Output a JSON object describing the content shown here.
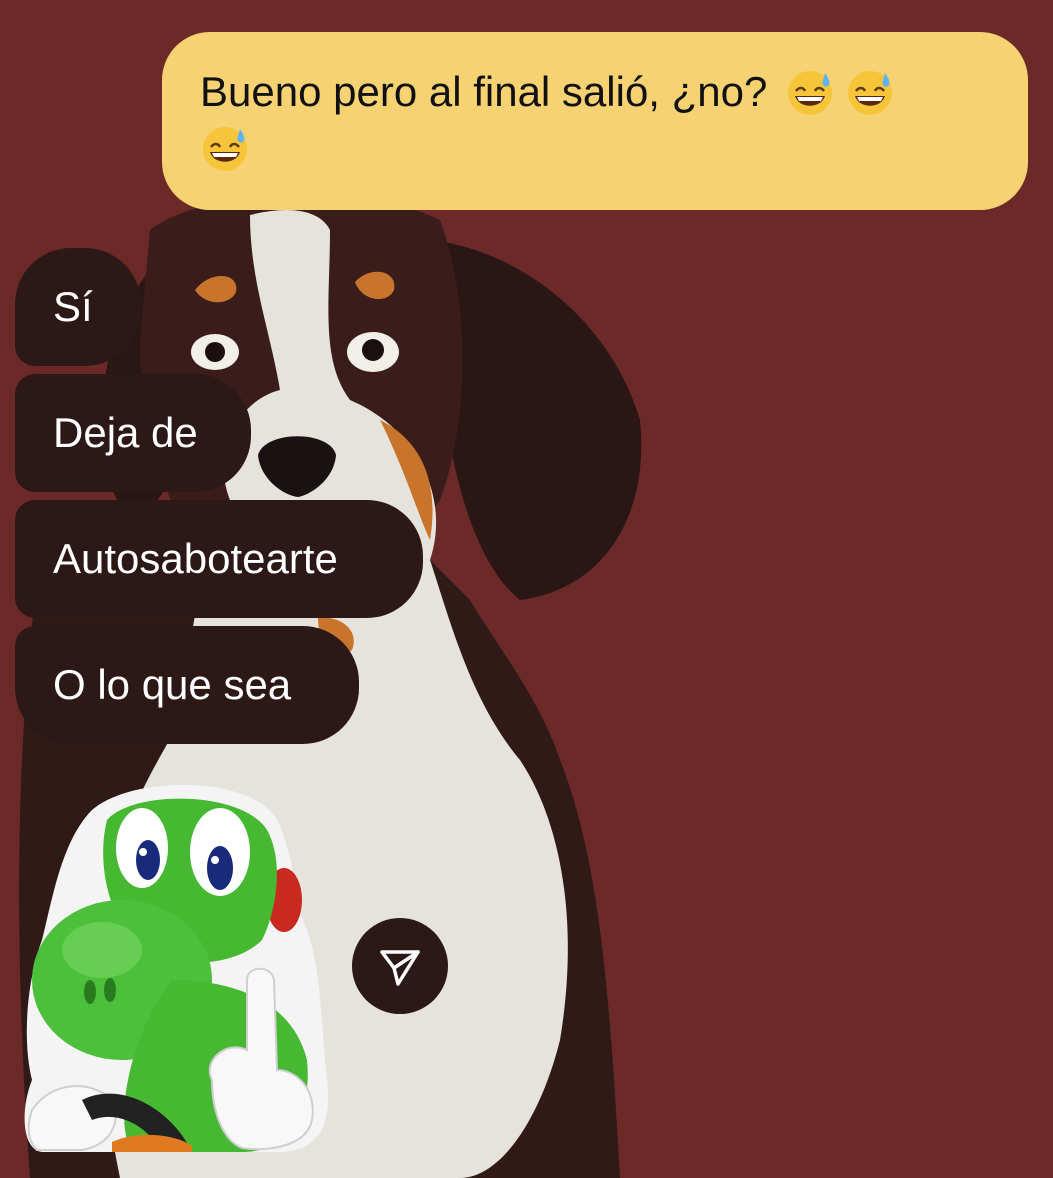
{
  "messages": {
    "outgoing": [
      {
        "text": "Bueno pero al final salió, ¿no?",
        "emojis": [
          "grinning-sweat-emoji",
          "grinning-sweat-emoji",
          "grinning-sweat-emoji"
        ]
      }
    ],
    "incoming": [
      {
        "text": "Sí"
      },
      {
        "text": "Deja de"
      },
      {
        "text": "Autosabotearte"
      },
      {
        "text": "O lo que sea"
      }
    ]
  },
  "sticker": {
    "icon": "yoshi-sticker"
  },
  "actions": {
    "share_icon": "paper-plane-icon"
  },
  "colors": {
    "background": "#6b2a28",
    "outgoing_bubble": "#f6d273",
    "incoming_bubble": "#2c1816"
  },
  "wallpaper": {
    "subject": "bernese-mountain-dog-illustration"
  }
}
